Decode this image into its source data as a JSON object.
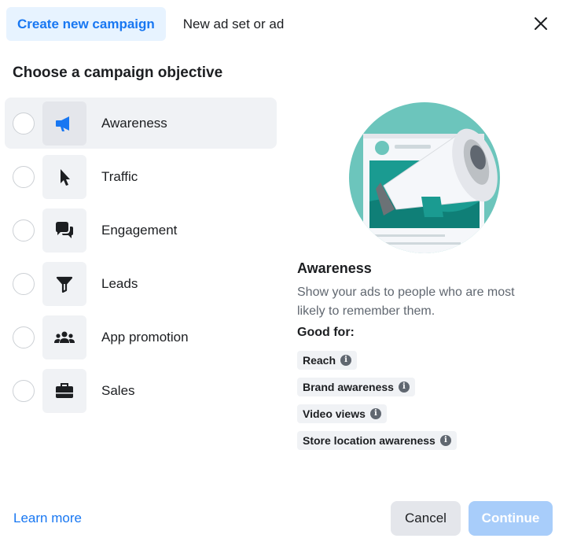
{
  "tabs": [
    {
      "label": "Create new campaign",
      "active": true
    },
    {
      "label": "New ad set or ad",
      "active": false
    }
  ],
  "close_icon": "close-icon",
  "section_title": "Choose a campaign objective",
  "objectives": [
    {
      "label": "Awareness",
      "icon": "megaphone-icon",
      "selected": true
    },
    {
      "label": "Traffic",
      "icon": "cursor-icon",
      "selected": false
    },
    {
      "label": "Engagement",
      "icon": "chat-bubbles-icon",
      "selected": false
    },
    {
      "label": "Leads",
      "icon": "funnel-icon",
      "selected": false
    },
    {
      "label": "App promotion",
      "icon": "people-icon",
      "selected": false
    },
    {
      "label": "Sales",
      "icon": "briefcase-icon",
      "selected": false
    }
  ],
  "detail": {
    "title": "Awareness",
    "description": "Show your ads to people who are most likely to remember them.",
    "good_for_label": "Good for:",
    "good_for": [
      "Reach",
      "Brand awareness",
      "Video views",
      "Store location awareness"
    ]
  },
  "footer": {
    "learn_more": "Learn more",
    "cancel": "Cancel",
    "continue": "Continue"
  },
  "colors": {
    "accent": "#1877f2",
    "tab_active_bg": "#e7f3ff",
    "continue_disabled_bg": "#a8cdfa",
    "illustration_teal": "#6cc5bc"
  }
}
